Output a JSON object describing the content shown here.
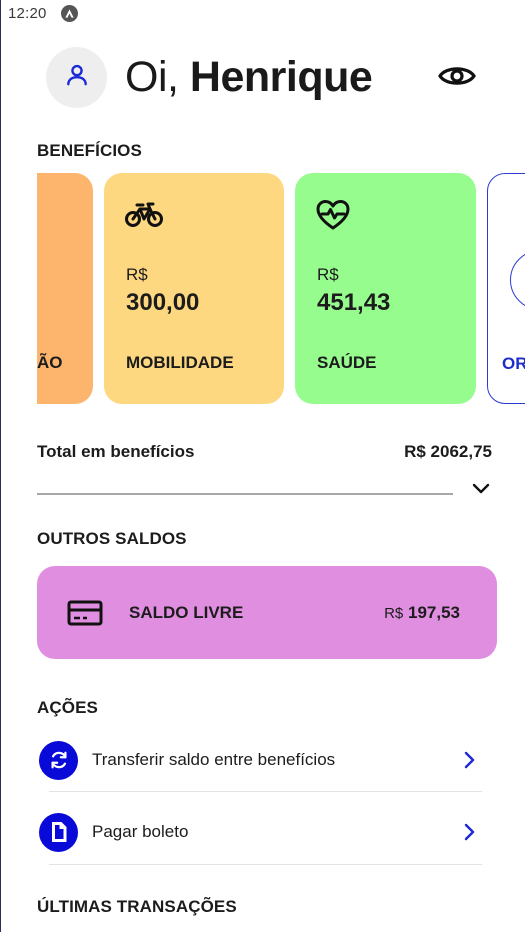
{
  "status_bar": {
    "time": "12:20",
    "app_indicator_icon": "android-icon"
  },
  "header": {
    "greeting": "Oi, ",
    "name": "Henrique",
    "avatar_icon": "user-icon",
    "visibility_icon": "eye-icon",
    "accent_color": "#1a2ad6"
  },
  "beneficios": {
    "title": "BENEFÍCIOS",
    "cards": [
      {
        "label": "ÃO",
        "color": "#fdb56e"
      },
      {
        "icon": "bicycle-icon",
        "currency": "R$",
        "amount": "300,00",
        "label": "MOBILIDADE",
        "color": "#fdd880"
      },
      {
        "icon": "heart-pulse-icon",
        "currency": "R$",
        "amount": "451,43",
        "label": "SAÚDE",
        "color": "#96fc8e"
      },
      {
        "label": "OR",
        "color": "#ffffff",
        "border_color": "#2b3cd6"
      }
    ]
  },
  "total": {
    "label": "Total em benefícios",
    "value": "R$ 2062,75",
    "expand_icon": "chevron-down-icon"
  },
  "outros_saldos": {
    "title": "OUTROS SALDOS",
    "card": {
      "icon": "credit-card-icon",
      "label": "SALDO LIVRE",
      "currency": "R$",
      "value": "197,53",
      "color": "#e08fe0"
    }
  },
  "acoes": {
    "title": "AÇÕES",
    "items": [
      {
        "icon": "sync-icon",
        "label": "Transferir saldo entre benefícios",
        "chevron": "chevron-right-icon"
      },
      {
        "icon": "document-icon",
        "label": "Pagar boleto",
        "chevron": "chevron-right-icon"
      }
    ]
  },
  "ultimas_transacoes": {
    "title": "ÚLTIMAS TRANSAÇÕES"
  }
}
